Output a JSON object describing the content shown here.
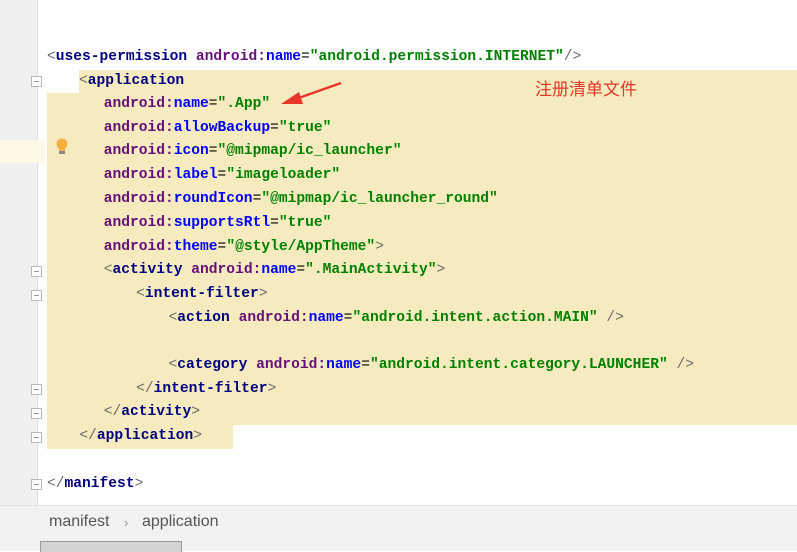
{
  "editor": {
    "lines": [
      {
        "indent": 0,
        "hl": false,
        "tokens": [
          [
            "br",
            "<"
          ],
          [
            "tag",
            "uses-permission"
          ],
          [
            "plain",
            " "
          ],
          [
            "ns",
            "android:"
          ],
          [
            "attr",
            "name"
          ],
          [
            "plain",
            "="
          ],
          [
            "val",
            "\"android.permission.INTERNET\""
          ],
          [
            "br",
            "/>"
          ]
        ]
      },
      {
        "indent": 4,
        "hl": true,
        "tokens": [
          [
            "br",
            "<"
          ],
          [
            "tag",
            "application"
          ]
        ]
      },
      {
        "indent": 7,
        "hl": true,
        "tokens": [
          [
            "ns",
            "android:"
          ],
          [
            "attr",
            "name"
          ],
          [
            "plain",
            "="
          ],
          [
            "val",
            "\".App\""
          ]
        ]
      },
      {
        "indent": 7,
        "hl": true,
        "tokens": [
          [
            "ns",
            "android:"
          ],
          [
            "attr",
            "allowBackup"
          ],
          [
            "plain",
            "="
          ],
          [
            "val",
            "\"true\""
          ]
        ]
      },
      {
        "indent": 7,
        "hl": true,
        "tokens": [
          [
            "ns",
            "android:"
          ],
          [
            "attr",
            "icon"
          ],
          [
            "plain",
            "="
          ],
          [
            "val",
            "\"@mipmap/ic_launcher\""
          ]
        ]
      },
      {
        "indent": 7,
        "hl": true,
        "tokens": [
          [
            "ns",
            "android:"
          ],
          [
            "attr",
            "label"
          ],
          [
            "plain",
            "="
          ],
          [
            "val",
            "\"imageloader\""
          ]
        ]
      },
      {
        "indent": 7,
        "hl": true,
        "tokens": [
          [
            "ns",
            "android:"
          ],
          [
            "attr",
            "roundIcon"
          ],
          [
            "plain",
            "="
          ],
          [
            "val",
            "\"@mipmap/ic_launcher_round\""
          ]
        ]
      },
      {
        "indent": 7,
        "hl": true,
        "tokens": [
          [
            "ns",
            "android:"
          ],
          [
            "attr",
            "supportsRtl"
          ],
          [
            "plain",
            "="
          ],
          [
            "val",
            "\"true\""
          ]
        ]
      },
      {
        "indent": 7,
        "hl": true,
        "tokens": [
          [
            "ns",
            "android:"
          ],
          [
            "attr",
            "theme"
          ],
          [
            "plain",
            "="
          ],
          [
            "val",
            "\"@style/AppTheme\""
          ],
          [
            "br",
            ">"
          ]
        ]
      },
      {
        "indent": 7,
        "hl": true,
        "tokens": [
          [
            "br",
            "<"
          ],
          [
            "tag",
            "activity"
          ],
          [
            "plain",
            " "
          ],
          [
            "ns",
            "android:"
          ],
          [
            "attr",
            "name"
          ],
          [
            "plain",
            "="
          ],
          [
            "val",
            "\".MainActivity\""
          ],
          [
            "br",
            ">"
          ]
        ]
      },
      {
        "indent": 11,
        "hl": true,
        "tokens": [
          [
            "br",
            "<"
          ],
          [
            "tag",
            "intent-filter"
          ],
          [
            "br",
            ">"
          ]
        ]
      },
      {
        "indent": 15,
        "hl": true,
        "tokens": [
          [
            "br",
            "<"
          ],
          [
            "tag",
            "action"
          ],
          [
            "plain",
            " "
          ],
          [
            "ns",
            "android:"
          ],
          [
            "attr",
            "name"
          ],
          [
            "plain",
            "="
          ],
          [
            "val",
            "\"android.intent.action.MAIN\""
          ],
          [
            "plain",
            " "
          ],
          [
            "br",
            "/>"
          ]
        ]
      },
      {
        "indent": 0,
        "hl": true,
        "tokens": []
      },
      {
        "indent": 15,
        "hl": true,
        "tokens": [
          [
            "br",
            "<"
          ],
          [
            "tag",
            "category"
          ],
          [
            "plain",
            " "
          ],
          [
            "ns",
            "android:"
          ],
          [
            "attr",
            "name"
          ],
          [
            "plain",
            "="
          ],
          [
            "val",
            "\"android.intent.category.LAUNCHER\""
          ],
          [
            "plain",
            " "
          ],
          [
            "br",
            "/>"
          ]
        ]
      },
      {
        "indent": 11,
        "hl": true,
        "tokens": [
          [
            "br",
            "</"
          ],
          [
            "tag",
            "intent-filter"
          ],
          [
            "br",
            ">"
          ]
        ]
      },
      {
        "indent": 7,
        "hl": true,
        "tokens": [
          [
            "br",
            "</"
          ],
          [
            "tag",
            "activity"
          ],
          [
            "br",
            ">"
          ]
        ]
      },
      {
        "indent": 4,
        "hl": "partial",
        "tokens": [
          [
            "br",
            "</"
          ],
          [
            "tag",
            "application"
          ],
          [
            "br",
            ">"
          ]
        ]
      },
      {
        "indent": 0,
        "hl": false,
        "tokens": []
      },
      {
        "indent": 0,
        "hl": false,
        "tokens": [
          [
            "br",
            "</"
          ],
          [
            "tag",
            "manifest"
          ],
          [
            "br",
            ">"
          ]
        ]
      }
    ]
  },
  "annotation": "注册清单文件",
  "breadcrumb": [
    "manifest",
    "application"
  ],
  "colors": {
    "highlight": "#f5ebbf",
    "tag": "#000080",
    "attribute": "#0000ff",
    "namespace": "#660e7a",
    "value": "#008000",
    "annotation": "#e8362b"
  }
}
